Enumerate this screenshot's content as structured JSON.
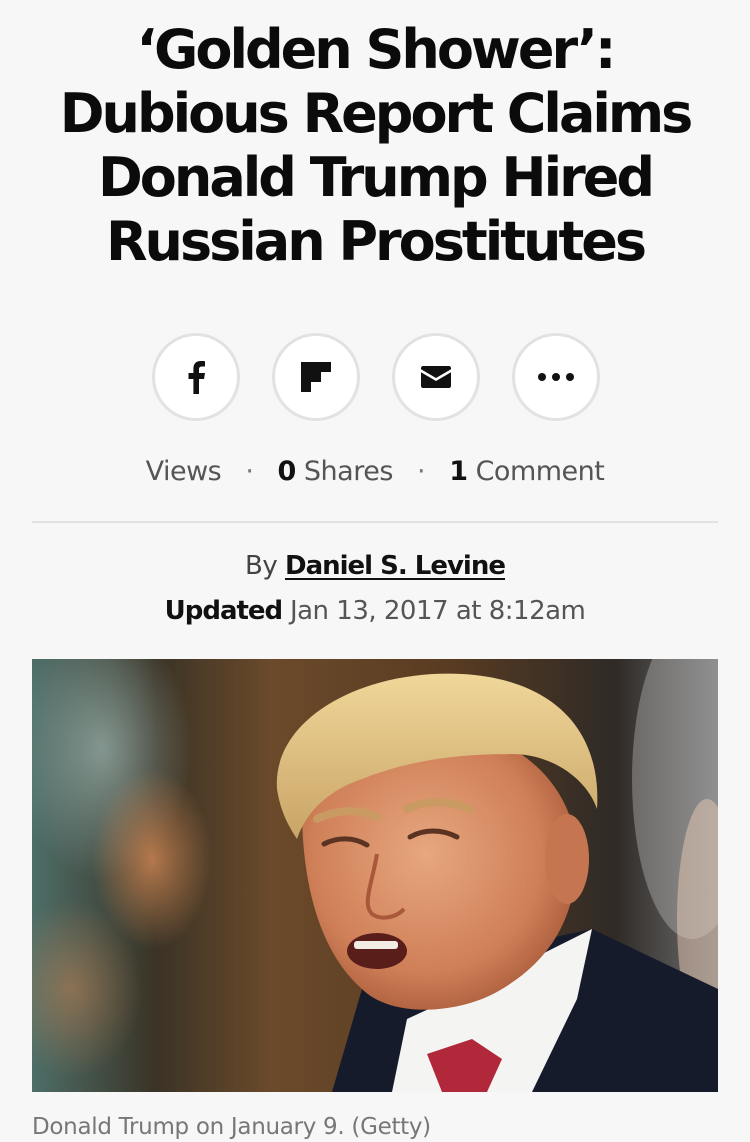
{
  "article": {
    "headline_lines": [
      "‘Golden Shower’:",
      "Dubious Report Claims",
      "Donald Trump Hired",
      "Russian Prostitutes"
    ]
  },
  "share": {
    "buttons": [
      {
        "name": "facebook",
        "icon": "facebook-icon"
      },
      {
        "name": "flipboard",
        "icon": "flipboard-icon"
      },
      {
        "name": "email",
        "icon": "email-icon"
      },
      {
        "name": "more",
        "icon": "more-icon"
      }
    ]
  },
  "stats": {
    "views_label": "Views",
    "shares_count": "0",
    "shares_label": "Shares",
    "comments_count": "1",
    "comments_label": "Comment",
    "separator": "·"
  },
  "byline": {
    "prefix": "By",
    "author": "Daniel S. Levine"
  },
  "updated": {
    "label": "Updated",
    "date": "Jan 13, 2017 at 8:12am"
  },
  "image": {
    "caption": "Donald Trump on January 9. (Getty)"
  }
}
